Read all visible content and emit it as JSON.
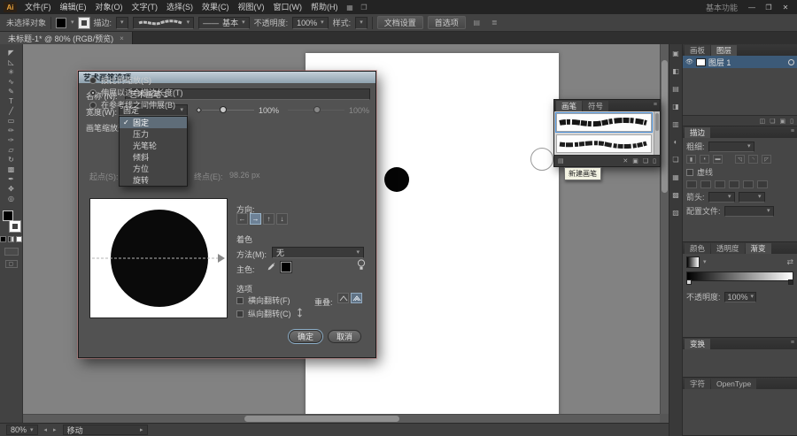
{
  "titlebar": {
    "logo": "Ai",
    "menus": [
      "文件(F)",
      "编辑(E)",
      "对象(O)",
      "文字(T)",
      "选择(S)",
      "效果(C)",
      "视图(V)",
      "窗口(W)",
      "帮助(H)"
    ],
    "workspace": "基本功能",
    "minimize": "—",
    "restore": "❐",
    "close": "✕"
  },
  "controlbar": {
    "no_selection": "未选择对象",
    "stroke_label": "描边:",
    "brush_definition": "基本",
    "opacity_label": "不透明度:",
    "opacity_value": "100%",
    "style_label": "样式:",
    "doc_setup": "文档设置",
    "preferences": "首选项"
  },
  "document_tab": {
    "title": "未标题-1* @ 80% (RGB/预览)",
    "close": "×"
  },
  "toolbar": {
    "tools": [
      {
        "name": "selection-tool",
        "glyph": "◤"
      },
      {
        "name": "direct-selection-tool",
        "glyph": "◺"
      },
      {
        "name": "magic-wand-tool",
        "glyph": "✳"
      },
      {
        "name": "lasso-tool",
        "glyph": "∿"
      },
      {
        "name": "pen-tool",
        "glyph": "✎"
      },
      {
        "name": "type-tool",
        "glyph": "T"
      },
      {
        "name": "line-segment-tool",
        "glyph": "╱"
      },
      {
        "name": "rectangle-tool",
        "glyph": "▭"
      },
      {
        "name": "paintbrush-tool",
        "glyph": "✏"
      },
      {
        "name": "pencil-tool",
        "glyph": "✑"
      },
      {
        "name": "eraser-tool",
        "glyph": "▱"
      },
      {
        "name": "rotate-tool",
        "glyph": "↻"
      },
      {
        "name": "gradient-tool",
        "glyph": "▩"
      },
      {
        "name": "eyedropper-tool",
        "glyph": "✒"
      },
      {
        "name": "hand-tool",
        "glyph": "✥"
      },
      {
        "name": "zoom-tool",
        "glyph": "◎"
      }
    ]
  },
  "dialog": {
    "title": "艺术画笔选项",
    "name_label": "名称 (N):",
    "name_value": "艺术画笔 1",
    "width_label": "宽度(W):",
    "width_value": "固定",
    "width_percent": "100%",
    "variation_percent": "100%",
    "width_options": [
      {
        "label": "固定",
        "checked": true
      },
      {
        "label": "压力",
        "checked": false
      },
      {
        "label": "光笔轮",
        "checked": false
      },
      {
        "label": "倾斜",
        "checked": false
      },
      {
        "label": "方位",
        "checked": false
      },
      {
        "label": "旋转",
        "checked": false
      }
    ],
    "scale_section_label": "画笔缩放选项",
    "scale_options": [
      {
        "label": "按比例缩放(S)",
        "selected": false
      },
      {
        "label": "伸展以适合描边长度(T)",
        "selected": true
      },
      {
        "label": "在参考线之间伸展(B)",
        "selected": false
      }
    ],
    "start_label": "起点(S):",
    "start_value": "0 px",
    "end_label": "终点(E):",
    "end_value": "98.26 px",
    "direction_label": "方向:",
    "direction_buttons": [
      {
        "name": "direction-left-button",
        "glyph": "←",
        "active": false
      },
      {
        "name": "direction-right-button",
        "glyph": "→",
        "active": true
      },
      {
        "name": "direction-up-button",
        "glyph": "↑",
        "active": false
      },
      {
        "name": "direction-down-button",
        "glyph": "↓",
        "active": false
      }
    ],
    "colorize_label": "着色",
    "method_label": "方法(M):",
    "method_value": "无",
    "key_color_label": "主色:",
    "options_label": "选项",
    "flip_along_label": "横向翻转(F)",
    "flip_across_label": "纵向翻转(C)",
    "overlap_label": "重叠:",
    "ok_label": "确定",
    "cancel_label": "取消"
  },
  "brushes_panel": {
    "tabs": [
      {
        "label": "画笔",
        "active": true
      },
      {
        "label": "符号",
        "active": false
      }
    ],
    "tooltip": "新建画笔"
  },
  "dock": {
    "strip_icons": [
      {
        "name": "info-panel-icon",
        "glyph": "▣"
      },
      {
        "name": "color-panel-icon",
        "glyph": "◧"
      },
      {
        "name": "swatches-panel-icon",
        "glyph": "▤"
      },
      {
        "name": "graphic-styles-panel-icon",
        "glyph": "◨"
      },
      {
        "name": "appearance-panel-icon",
        "glyph": "▥"
      },
      {
        "name": "transparency-panel-icon",
        "glyph": "◐"
      },
      {
        "name": "symbols-panel-icon",
        "glyph": "❏"
      },
      {
        "name": "stroke-panel-icon",
        "glyph": "▦"
      },
      {
        "name": "gradient-panel-icon",
        "glyph": "▩"
      },
      {
        "name": "libraries-panel-icon",
        "glyph": "▧"
      }
    ],
    "layers": {
      "tabs": [
        {
          "label": "画板",
          "active": false
        },
        {
          "label": "图层",
          "active": true
        }
      ],
      "layer_name": "图层 1"
    },
    "stroke": {
      "tab": "描边",
      "weight_label": "粗细:",
      "dashed_label": "虚线",
      "arrow_label": "箭头:",
      "profile_label": "配置文件:"
    },
    "gradient": {
      "tabs": [
        {
          "label": "颜色",
          "active": false
        },
        {
          "label": "透明度",
          "active": false
        },
        {
          "label": "渐变",
          "active": true
        }
      ],
      "opacity_label": "不透明度:",
      "opacity_value": "100%"
    },
    "transform_label": "变换",
    "bottom_tabs": [
      {
        "label": "字符",
        "active": false
      },
      {
        "label": "OpenType",
        "active": false
      }
    ]
  },
  "statusbar": {
    "zoom": "80%",
    "tool": "移动"
  }
}
